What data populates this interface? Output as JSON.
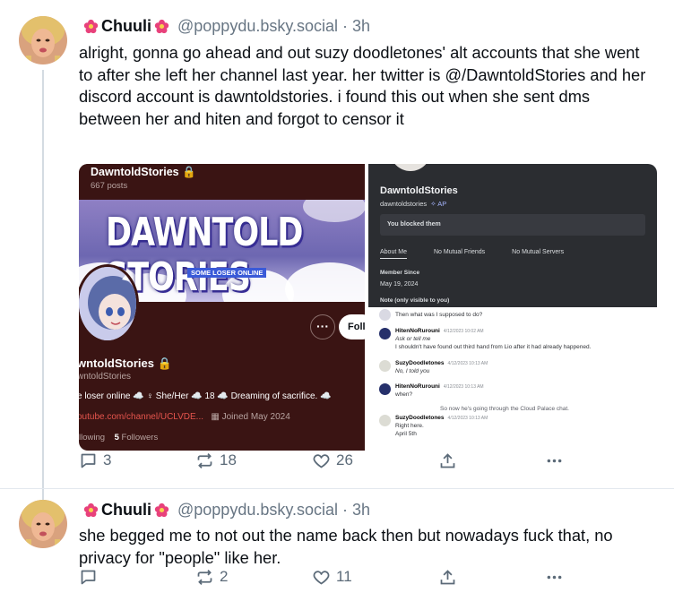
{
  "posts": [
    {
      "author_name": "Chuuli",
      "handle": "@poppydu.bsky.social",
      "separator": "·",
      "time": "3h",
      "text": "alright, gonna go ahead and out suzy doodletones' alt accounts that she went to after she left her channel last year. her twitter is @/DawntoldStories and her discord account is dawntoldstories. i found this out when she sent dms between her and hiten and forgot to censor it",
      "replies": "3",
      "reposts": "18",
      "likes": "26"
    },
    {
      "author_name": "Chuuli",
      "handle": "@poppydu.bsky.social",
      "separator": "·",
      "time": "3h",
      "text": "she begged me to not out the name back then but nowadays fuck that, no privacy for \"people\" like her.",
      "replies": "",
      "reposts": "2",
      "likes": "11"
    }
  ],
  "twitter_screenshot": {
    "name": "DawntoldStories",
    "posts_count": "667 posts",
    "banner_title": "DAWNTOLD STORIES",
    "banner_subtitle": "SOME LOSER ONLINE",
    "follow_label": "Follo",
    "more_label": "···",
    "profile_name": "wntoldStories",
    "profile_handle": "wntoldStories",
    "bio": "e loser online ☁️ ♀ She/Her ☁️ 18 ☁️ Dreaming of sacrifice. ☁️",
    "link": "outube.com/channel/UCLVDE...",
    "joined": "Joined May 2024",
    "following_label": "llowing",
    "followers_count": "5",
    "followers_label": "Followers"
  },
  "discord_screenshot": {
    "name": "DawntoldStories",
    "username": "dawntoldstories",
    "badge": "✧ AP",
    "blocked_text": "You blocked them",
    "tabs": [
      "About Me",
      "No Mutual Friends",
      "No Mutual Servers"
    ],
    "member_since_label": "Member Since",
    "member_since": "May 19, 2024",
    "note_label": "Note (only visible to you)",
    "messages": [
      {
        "who": "",
        "stamp": "",
        "lines": [
          "Then what was I supposed to do?"
        ]
      },
      {
        "who": "HitenNoRurouni",
        "stamp": "4/12/2023 10:02 AM",
        "lines": [
          "Ask or tell me",
          "I shouldn't have found out third hand from Lio after it had already happened."
        ]
      },
      {
        "who": "SuzyDoodletones",
        "stamp": "4/12/2023 10:13 AM",
        "lines": [
          "No, I told you"
        ]
      },
      {
        "who": "HitenNoRurouni",
        "stamp": "4/12/2023 10:13 AM",
        "lines": [
          "when?"
        ]
      },
      {
        "who": "SuzyDoodletones",
        "stamp": "4/12/2023 10:13 AM",
        "lines": [
          "Right here.",
          "April 5th"
        ]
      }
    ],
    "reply_preview": "So now he's going through the Cloud Palace chat."
  }
}
